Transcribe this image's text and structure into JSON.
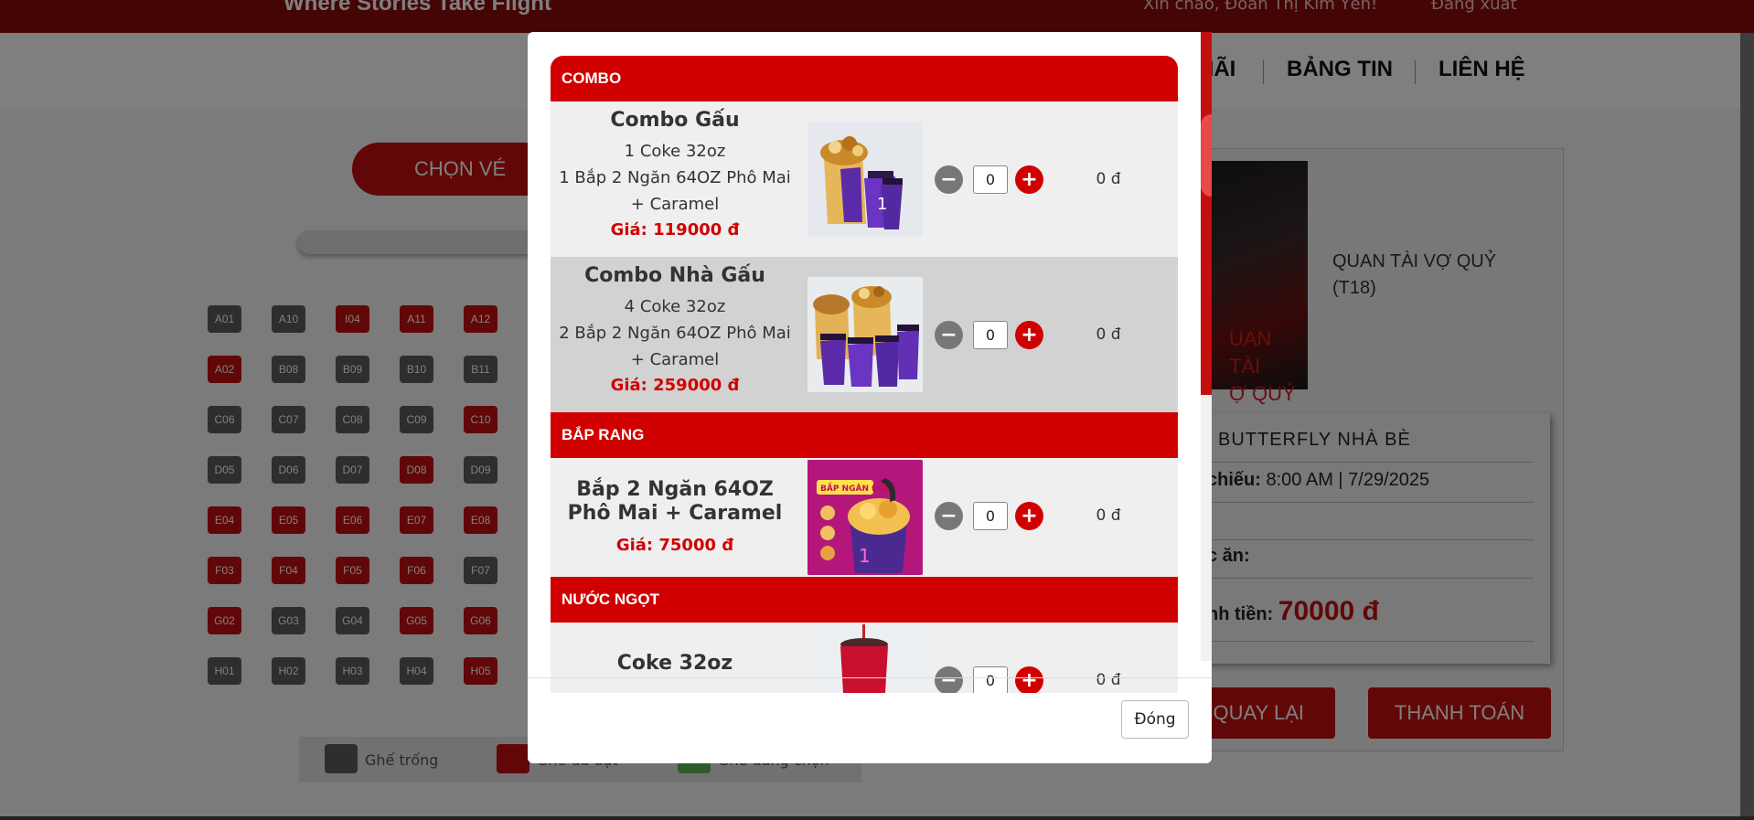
{
  "header": {
    "slogan": "Where Stories Take Flight",
    "greeting": "Xin chào, Đoàn Thị Kim Yến!",
    "logout": "Đăng xuất"
  },
  "nav": {
    "items": [
      "HÃI",
      "BẢNG TIN",
      "LIÊN HỆ"
    ]
  },
  "booking": {
    "tab_label": "CHỌN VÉ",
    "seats": [
      {
        "id": "A01",
        "status": "free"
      },
      {
        "id": "A10",
        "status": "free"
      },
      {
        "id": "I04",
        "status": "booked"
      },
      {
        "id": "A11",
        "status": "booked"
      },
      {
        "id": "A12",
        "status": "booked"
      },
      {
        "id": "A02",
        "status": "booked"
      },
      {
        "id": "B08",
        "status": "free"
      },
      {
        "id": "B09",
        "status": "free"
      },
      {
        "id": "B10",
        "status": "free"
      },
      {
        "id": "B11",
        "status": "free"
      },
      {
        "id": "C06",
        "status": "free"
      },
      {
        "id": "C07",
        "status": "free"
      },
      {
        "id": "C08",
        "status": "free"
      },
      {
        "id": "C09",
        "status": "free"
      },
      {
        "id": "C10",
        "status": "booked"
      },
      {
        "id": "D05",
        "status": "free"
      },
      {
        "id": "D06",
        "status": "free"
      },
      {
        "id": "D07",
        "status": "free"
      },
      {
        "id": "D08",
        "status": "booked"
      },
      {
        "id": "D09",
        "status": "free"
      },
      {
        "id": "E04",
        "status": "booked"
      },
      {
        "id": "E05",
        "status": "booked"
      },
      {
        "id": "E06",
        "status": "booked"
      },
      {
        "id": "E07",
        "status": "booked"
      },
      {
        "id": "E08",
        "status": "booked"
      },
      {
        "id": "F03",
        "status": "booked"
      },
      {
        "id": "F04",
        "status": "booked"
      },
      {
        "id": "F05",
        "status": "booked"
      },
      {
        "id": "F06",
        "status": "booked"
      },
      {
        "id": "F07",
        "status": "free"
      },
      {
        "id": "G02",
        "status": "booked"
      },
      {
        "id": "G03",
        "status": "free"
      },
      {
        "id": "G04",
        "status": "free"
      },
      {
        "id": "G05",
        "status": "booked"
      },
      {
        "id": "G06",
        "status": "booked"
      },
      {
        "id": "H01",
        "status": "free"
      },
      {
        "id": "H02",
        "status": "free"
      },
      {
        "id": "H03",
        "status": "free"
      },
      {
        "id": "H04",
        "status": "free"
      },
      {
        "id": "H05",
        "status": "booked"
      }
    ],
    "legend": {
      "free": "Ghế trống",
      "booked": "Ghế đã đặt",
      "selected": "Ghế đang chọn"
    }
  },
  "movie": {
    "poster_text": "UAN TÀI\nỢ QUỶ",
    "title": "QUAN TÀI VỢ QUỶ (T18)",
    "cinema": "BUTTERFLY NHÀ BÈ",
    "showtime_label": "chiếu:",
    "showtime_value": "8:00 AM | 7/29/2025",
    "food_label": "c ăn:",
    "total_label": "nh tiền:",
    "total_value": "70000 đ",
    "back_label": "QUAY LẠI",
    "pay_label": "THANH TOÁN"
  },
  "modal": {
    "sections": [
      {
        "title": "COMBO",
        "items": [
          {
            "name": "Combo Gấu",
            "desc": [
              "1 Coke 32oz",
              "1 Bắp 2 Ngăn 64OZ Phô Mai + Caramel"
            ],
            "price": "Giá: 119000 đ",
            "qty": "0",
            "subtotal": "0 đ"
          },
          {
            "name": "Combo Nhà Gấu",
            "desc": [
              "4 Coke 32oz",
              "2 Bắp 2 Ngăn 64OZ Phô Mai + Caramel"
            ],
            "price": "Giá: 259000 đ",
            "qty": "0",
            "subtotal": "0 đ"
          }
        ]
      },
      {
        "title": "BẮP RANG",
        "items": [
          {
            "name": "Bắp 2 Ngăn 64OZ Phô Mai + Caramel",
            "desc": [],
            "price": "Giá: 75000 đ",
            "qty": "0",
            "subtotal": "0 đ"
          }
        ]
      },
      {
        "title": "NƯỚC NGỌT",
        "items": [
          {
            "name": "Coke 32oz",
            "desc": [],
            "price": "",
            "qty": "0",
            "subtotal": "0 đ"
          }
        ]
      }
    ],
    "image_label_popcorn": "BẮP NGĂN ĐÔI",
    "close_label": "Đóng"
  },
  "colors": {
    "brand_red": "#d10000",
    "dark_red": "#8b0a0a",
    "seat_free": "#5c5c5c",
    "seat_booked": "#c50f0f",
    "seat_selected": "#5cb85c"
  }
}
